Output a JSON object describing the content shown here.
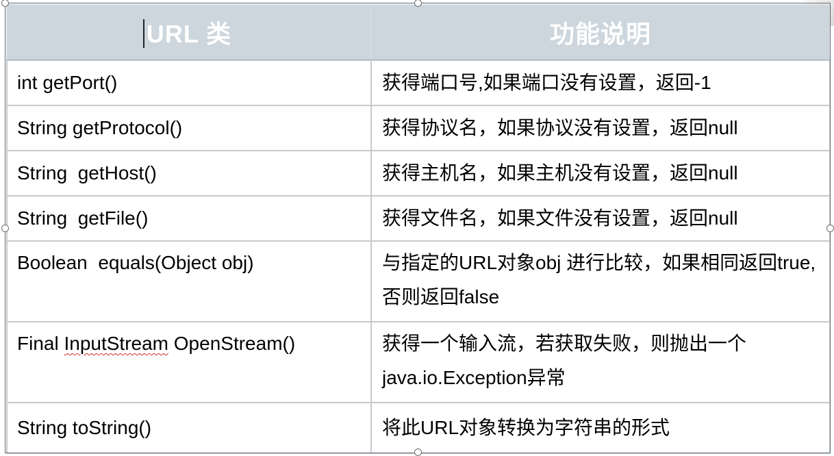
{
  "table": {
    "headers": [
      "URL 类",
      "功能说明"
    ],
    "rows": [
      {
        "method": "int getPort()",
        "desc": "获得端口号,如果端口没有设置，返回-1"
      },
      {
        "method": "String getProtocol()",
        "desc": "获得协议名，如果协议没有设置，返回null"
      },
      {
        "method": "String  getHost()",
        "desc": "获得主机名，如果主机没有设置，返回null"
      },
      {
        "method": "String  getFile()",
        "desc": "获得文件名，如果文件没有设置，返回null"
      },
      {
        "method": "Boolean  equals(Object obj)",
        "desc": "与指定的URL对象obj 进行比较，如果相同返回true,否则返回false"
      },
      {
        "method_prefix": "Final ",
        "method_flagged": "InputStream",
        "method_suffix": " OpenStream()",
        "desc": "获得一个输入流，若获取失败，则抛出一个java.io.Exception异常"
      },
      {
        "method": "String toString()",
        "desc": "将此URL对象转换为字符串的形式"
      }
    ]
  },
  "colors": {
    "header_bg": "#ccd6dc",
    "header_text": "#ffffff",
    "grid_line": "#c8c8c8",
    "spellcheck_underline": "#d03030"
  }
}
